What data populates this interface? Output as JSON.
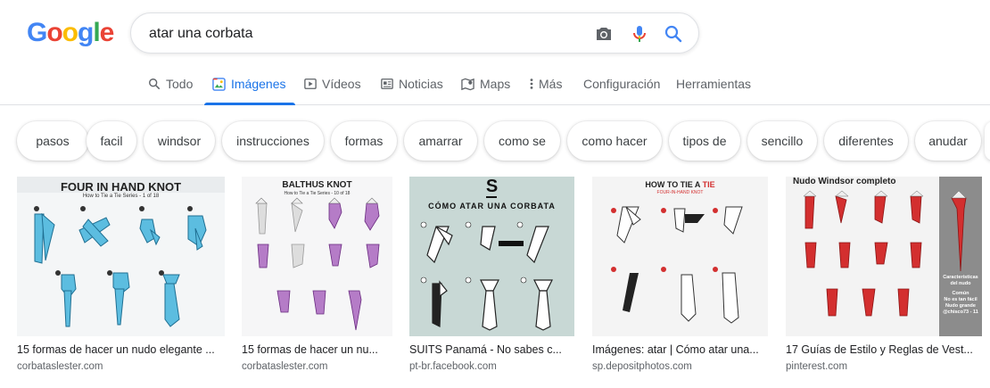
{
  "logo": {
    "letters": [
      "G",
      "o",
      "o",
      "g",
      "l",
      "e"
    ],
    "colors": [
      "#4285F4",
      "#EA4335",
      "#FBBC05",
      "#4285F4",
      "#34A853",
      "#EA4335"
    ]
  },
  "search": {
    "query": "atar una corbata"
  },
  "tabs": [
    {
      "label": "Todo",
      "icon": "search-icon"
    },
    {
      "label": "Imágenes",
      "icon": "image-icon",
      "active": true
    },
    {
      "label": "Vídeos",
      "icon": "play-icon"
    },
    {
      "label": "Noticias",
      "icon": "newspaper-icon"
    },
    {
      "label": "Maps",
      "icon": "map-icon"
    },
    {
      "label": "Más",
      "icon": "dots-vertical-icon"
    },
    {
      "label": "Configuración"
    },
    {
      "label": "Herramientas"
    }
  ],
  "chips": [
    "pasos",
    "facil",
    "windsor",
    "instrucciones",
    "formas",
    "amarrar",
    "como se",
    "como hacer",
    "tipos de",
    "sencillo",
    "diferentes",
    "anudar"
  ],
  "results": [
    {
      "caption": "15 formas de hacer un nudo elegante ...",
      "source": "corbataslester.com",
      "img_title": "FOUR IN HAND KNOT",
      "img_subtitle": "How to Tie a Tie Series - 1 of 18",
      "tie_color": "#4fb3d9"
    },
    {
      "caption": "15 formas de hacer un nu...",
      "source": "corbataslester.com",
      "img_title": "BALTHUS KNOT",
      "img_subtitle": "How to Tie a Tie Series - 10 of 18",
      "tie_color": "#b56fc4"
    },
    {
      "caption": "SUITS Panamá - No sabes c...",
      "source": "pt-br.facebook.com",
      "img_logo": "S",
      "img_title": "CÓMO ATAR UNA CORBATA",
      "tie_color": "#ffffff"
    },
    {
      "caption": "Imágenes: atar | Cómo atar una...",
      "source": "sp.depositphotos.com",
      "img_title_a": "HOW TO TIE A ",
      "img_title_b": "TIE",
      "img_subtitle": "FOUR-IN-HAND KNOT",
      "tie_color": "#ffffff"
    },
    {
      "caption": "17 Guías de Estilo y Reglas de Vest...",
      "source": "pinterest.com",
      "img_title": "Nudo Windsor completo",
      "img_note": "Características del nudo",
      "img_note2": "Común",
      "img_note3": "No es tan fácil",
      "img_note4": "Nudo grande",
      "img_note5": "@chisco73 - 11",
      "tie_color": "#d32f2f"
    }
  ]
}
